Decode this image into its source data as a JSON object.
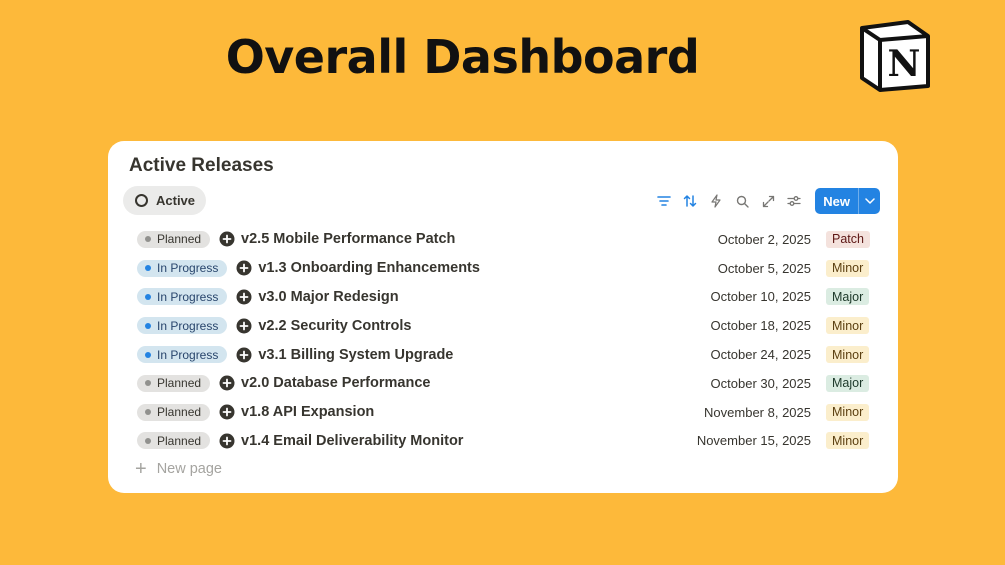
{
  "page_title": "Overall Dashboard",
  "logo": {
    "letter": "N",
    "icon": "notion-logo"
  },
  "database": {
    "title": "Active Releases",
    "view_tab": "Active",
    "toolbar": {
      "icons": [
        "filter-icon",
        "sort-icon",
        "automation-bolt-icon",
        "search-icon",
        "expand-icon",
        "settings-sliders-icon"
      ],
      "new_label": "New"
    },
    "rows": [
      {
        "status": "Planned",
        "status_type": "planned",
        "title": "v2.5 Mobile Performance Patch",
        "date": "October 2, 2025",
        "tag": "Patch",
        "tag_type": "patch"
      },
      {
        "status": "In Progress",
        "status_type": "progress",
        "title": "v1.3 Onboarding Enhancements",
        "date": "October 5, 2025",
        "tag": "Minor",
        "tag_type": "minor"
      },
      {
        "status": "In Progress",
        "status_type": "progress",
        "title": "v3.0 Major Redesign",
        "date": "October 10, 2025",
        "tag": "Major",
        "tag_type": "major"
      },
      {
        "status": "In Progress",
        "status_type": "progress",
        "title": "v2.2 Security Controls",
        "date": "October 18, 2025",
        "tag": "Minor",
        "tag_type": "minor"
      },
      {
        "status": "In Progress",
        "status_type": "progress",
        "title": "v3.1 Billing System Upgrade",
        "date": "October 24, 2025",
        "tag": "Minor",
        "tag_type": "minor"
      },
      {
        "status": "Planned",
        "status_type": "planned",
        "title": "v2.0 Database Performance",
        "date": "October 30, 2025",
        "tag": "Major",
        "tag_type": "major"
      },
      {
        "status": "Planned",
        "status_type": "planned",
        "title": "v1.8 API Expansion",
        "date": "November 8, 2025",
        "tag": "Minor",
        "tag_type": "minor"
      },
      {
        "status": "Planned",
        "status_type": "planned",
        "title": "v1.4 Email Deliverability Monitor",
        "date": "November 15, 2025",
        "tag": "Minor",
        "tag_type": "minor"
      }
    ],
    "new_page_label": "New page"
  },
  "colors": {
    "background": "#FDB93A",
    "accent": "#2383e2",
    "planned_bg": "#e3e2e0",
    "progress_bg": "#d3e5ef",
    "patch_bg": "#f4e2dd",
    "minor_bg": "#fbeecc",
    "major_bg": "#dbece2"
  }
}
